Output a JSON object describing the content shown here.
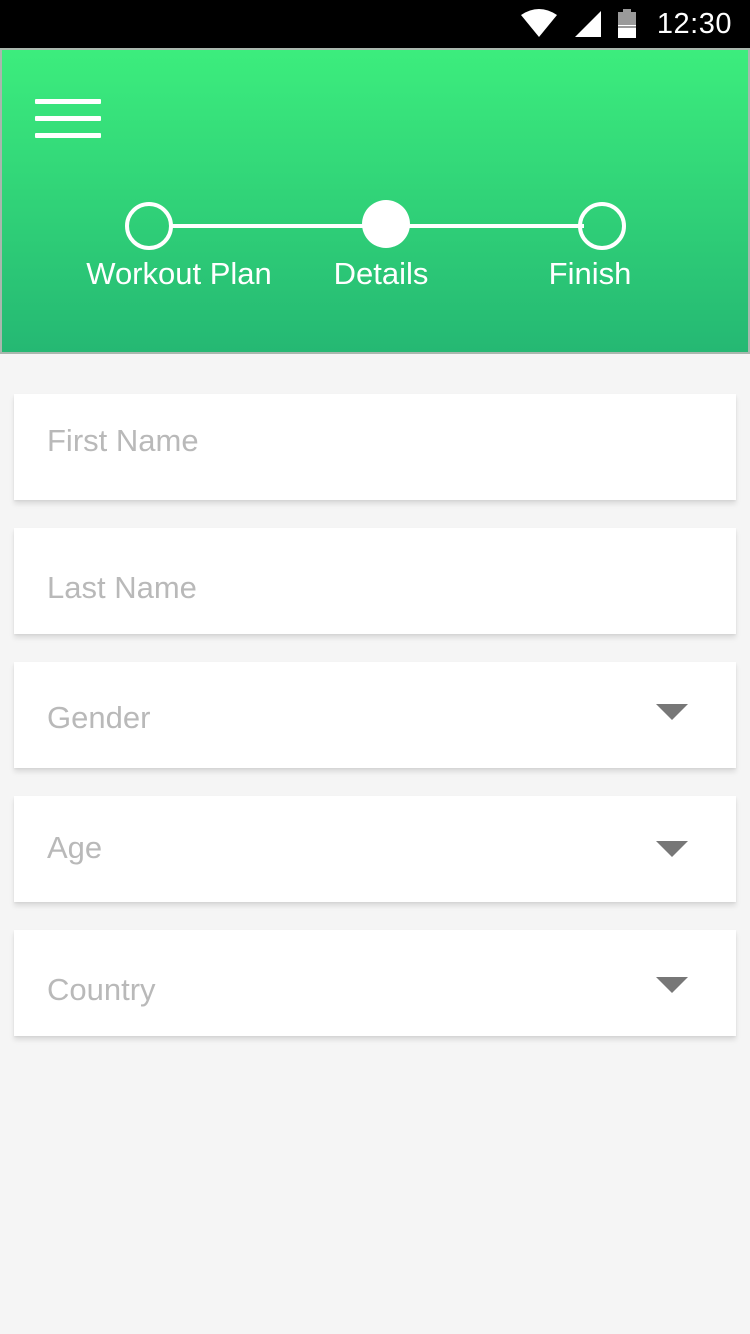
{
  "status_bar": {
    "time": "12:30",
    "icons": [
      "wifi-icon",
      "signal-icon",
      "battery-icon"
    ]
  },
  "header": {
    "menu_icon": "menu-icon",
    "steps": [
      {
        "label": "Workout Plan",
        "state": "pending"
      },
      {
        "label": "Details",
        "state": "active"
      },
      {
        "label": "Finish",
        "state": "pending"
      }
    ]
  },
  "form": {
    "first_name": {
      "placeholder": "First Name",
      "value": ""
    },
    "last_name": {
      "placeholder": "Last Name",
      "value": ""
    },
    "gender": {
      "placeholder": "Gender",
      "value": ""
    },
    "age": {
      "placeholder": "Age",
      "value": ""
    },
    "country": {
      "placeholder": "Country",
      "value": ""
    }
  },
  "colors": {
    "header_top": "#3ced7d",
    "header_bottom": "#25b873",
    "background": "#f5f5f5",
    "placeholder": "#b9b9b9",
    "caret": "#777777"
  }
}
